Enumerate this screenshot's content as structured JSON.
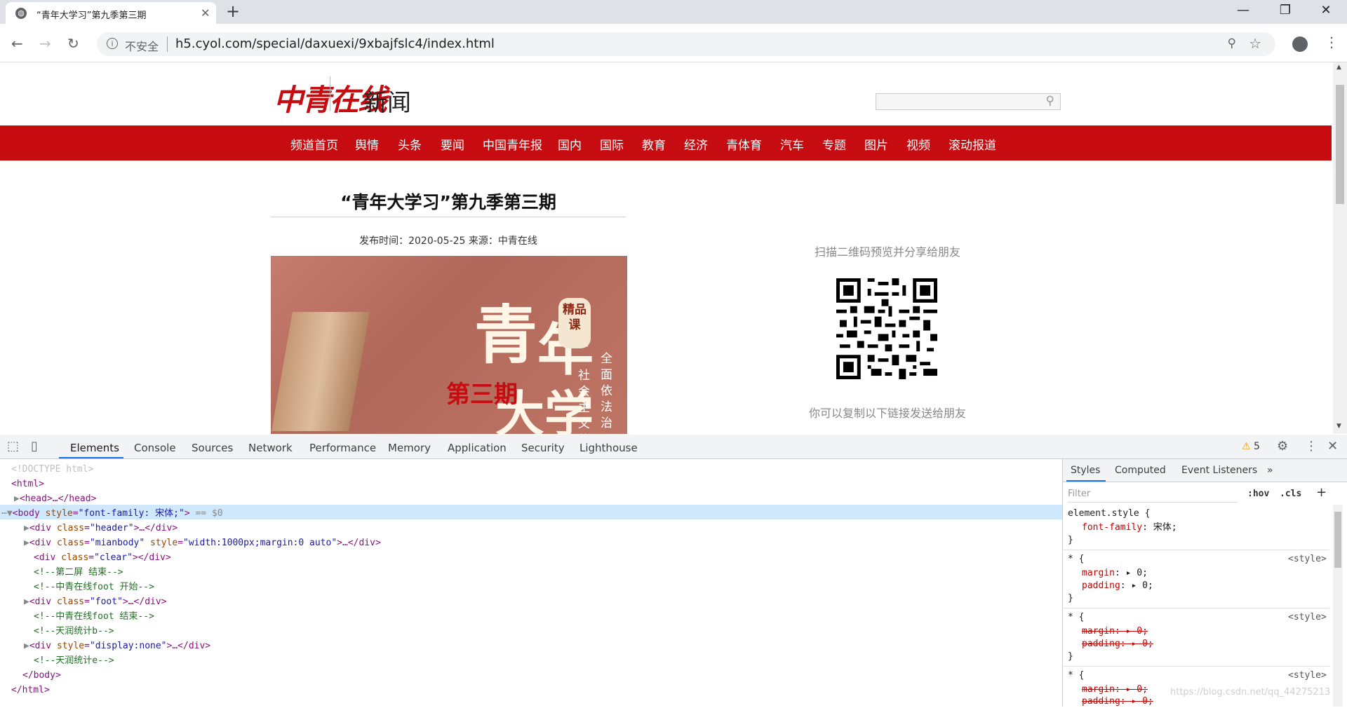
{
  "browser": {
    "tab_title": "“青年大学习”第九季第三期",
    "tab_favicon": "globe-icon",
    "new_tab": "+",
    "minimize": "—",
    "restore": "❐",
    "close": "✕",
    "security_label": "不安全",
    "url": "h5.cyol.com/special/daxuexi/9xbajfslc4/index.html"
  },
  "site": {
    "logo": "中青在线",
    "channel": "新闻",
    "search_value": "",
    "nav": [
      "频道首页",
      "舆情",
      "头条",
      "要闻",
      "中国青年报",
      "国内",
      "国际",
      "教育",
      "经济",
      "青体育",
      "汽车",
      "专题",
      "图片",
      "视频",
      "滚动报道"
    ],
    "accent_color": "#c70c11"
  },
  "article": {
    "title": "“青年大学习”第九季第三期",
    "meta": "发布时间：2020-05-25   来源：中青在线",
    "hero": {
      "big1": "青",
      "big2": "年",
      "big3": "大学",
      "red": "第三期",
      "badge": "精品课",
      "col1": "全面依法治",
      "col2": "社会主义的"
    }
  },
  "share": {
    "qr_caption": "扫描二维码预览并分享给朋友",
    "share_caption": "你可以复制以下链接发送给朋友"
  },
  "devtools": {
    "tabs": [
      "Elements",
      "Console",
      "Sources",
      "Network",
      "Performance",
      "Memory",
      "Application",
      "Security",
      "Lighthouse"
    ],
    "active_tab": "Elements",
    "warnings_count": "5",
    "dom": {
      "doctype": "<!DOCTYPE html>",
      "html_open": "<html>",
      "head": "<head>…</head>",
      "body_tag": "body",
      "body_attr": "style",
      "body_val": "\"font-family: 宋体;\"",
      "body_eq": " == $0",
      "div1_class": "\"header\"",
      "div2_class": "\"mianbody\"",
      "div2_style_attr": "style",
      "div2_style": "\"width:1000px;margin:0 auto\"",
      "div3_class": "\"clear\"",
      "c1": "<!--第二屏 结束-->",
      "c2": "<!--中青在线foot 开始-->",
      "div4_class": "\"foot\"",
      "c3": "<!--中青在线foot 结束-->",
      "c4": "<!--天润统计b-->",
      "div5_style": "\"display:none\"",
      "c5": "<!--天润统计e-->",
      "body_close": "</body>",
      "html_close": "</html>"
    },
    "styles": {
      "tabs": [
        "Styles",
        "Computed",
        "Event Listeners"
      ],
      "more": "»",
      "filter_placeholder": "Filter",
      "hov": ":hov",
      "cls": ".cls",
      "add": "+",
      "element_style": "element.style {",
      "rule1_prop": "font-family",
      "rule1_val": "宋体;",
      "close_brace": "}",
      "star_open": "* {",
      "source": "<style>",
      "margin": "margin",
      "padding": "padding",
      "zero": "0;"
    }
  },
  "watermark": "https://blog.csdn.net/qq_44275213"
}
